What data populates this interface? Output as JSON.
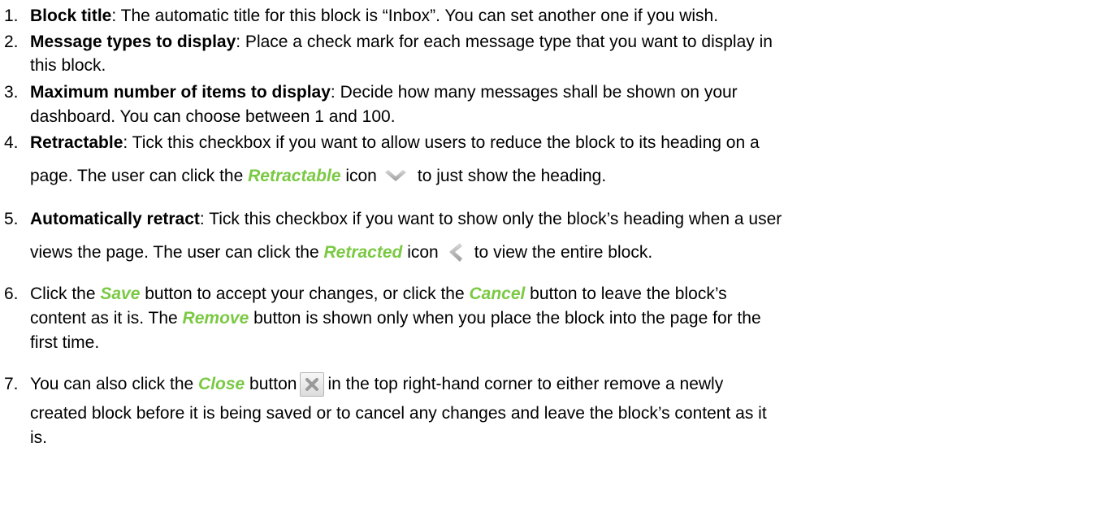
{
  "items": [
    {
      "num": "1.",
      "term": "Block title",
      "text": ": The automatic title for this block is “Inbox”. You can set another one if you wish."
    },
    {
      "num": "2.",
      "term": "Message types to display",
      "text1": ": Place a check mark for each message type that you want to display in",
      "text2": "this block."
    },
    {
      "num": "3.",
      "term": "Maximum number of items to display",
      "text1": ": Decide how many messages shall be shown on your",
      "text2": "dashboard. You can choose between 1 and 100."
    },
    {
      "num": "4.",
      "term": "Retractable",
      "text1": ": Tick this checkbox if you want to allow users to reduce the block to its heading on a",
      "text2a": "page. The user can click the ",
      "ui": "Retractable",
      "text2b": " icon",
      "text2c": "to just show the heading."
    },
    {
      "num": "5.",
      "term": "Automatically retract",
      "text1": ": Tick this checkbox if you want to show only the block’s heading when a user",
      "text2a": "views the page. The user can click the ",
      "ui": "Retracted",
      "text2b": " icon",
      "text2c": "to view the entire block."
    },
    {
      "num": "6.",
      "line1a": "Click the ",
      "save": "Save",
      "line1b": " button to accept your changes, or click the ",
      "cancel": "Cancel",
      "line1c": " button to leave the block’s",
      "line2a": "content as it is. The ",
      "remove": "Remove",
      "line2b": " button is shown only when you place the block into the page for the",
      "line3": "first time."
    },
    {
      "num": "7.",
      "line1a": "You can also click the ",
      "close": "Close",
      "line1b": " button",
      "line1c": "in the top right-hand corner to either remove a newly",
      "line2": "created block before it is being saved or to cancel any changes and leave the block’s content as it",
      "line3": "is."
    }
  ],
  "colors": {
    "ui_term": "#7ac943",
    "text": "#000000"
  },
  "icons": {
    "retractable": "chevron-down-icon",
    "retracted": "chevron-left-icon",
    "close": "close-icon"
  }
}
